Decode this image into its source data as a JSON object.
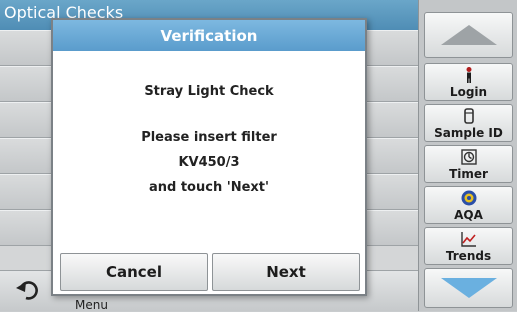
{
  "background": {
    "title": "Optical Checks",
    "menu_label": "Menu"
  },
  "dialog": {
    "title": "Verification",
    "line1": "Stray Light Check",
    "line2": "Please insert filter",
    "line3": "KV450/3",
    "line4": "and touch 'Next'",
    "cancel_label": "Cancel",
    "next_label": "Next"
  },
  "sidebar": {
    "login_label": "Login",
    "sample_id_label": "Sample ID",
    "timer_label": "Timer",
    "aqa_label": "AQA",
    "trends_label": "Trends"
  },
  "colors": {
    "title_blue": "#5a9ccc",
    "sidebar_arrow": "#6ab0e0"
  }
}
